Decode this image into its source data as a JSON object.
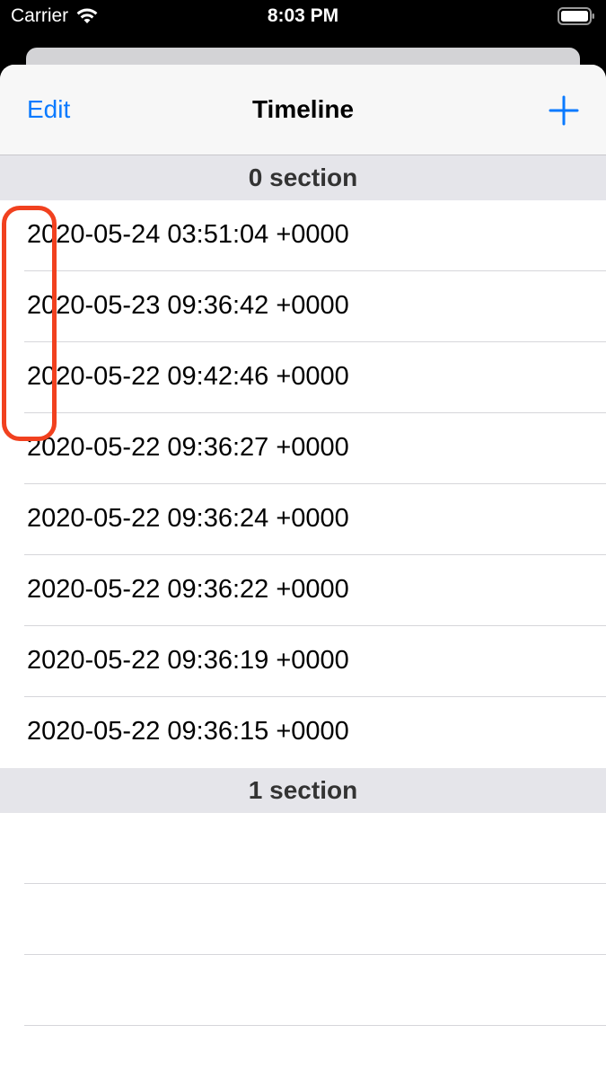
{
  "status_bar": {
    "carrier": "Carrier",
    "time": "8:03 PM"
  },
  "nav": {
    "edit_label": "Edit",
    "title": "Timeline",
    "add_icon": "plus-icon"
  },
  "sections": [
    {
      "header": "0 section",
      "rows": [
        "2020-05-24 03:51:04 +0000",
        "2020-05-23 09:36:42 +0000",
        "2020-05-22 09:42:46 +0000",
        "2020-05-22 09:36:27 +0000",
        "2020-05-22 09:36:24 +0000",
        "2020-05-22 09:36:22 +0000",
        "2020-05-22 09:36:19 +0000",
        "2020-05-22 09:36:15 +0000"
      ]
    },
    {
      "header": "1 section",
      "rows": [
        "",
        "",
        "",
        ""
      ]
    }
  ],
  "colors": {
    "accent": "#0a7aff",
    "highlight": "#f1411f"
  }
}
